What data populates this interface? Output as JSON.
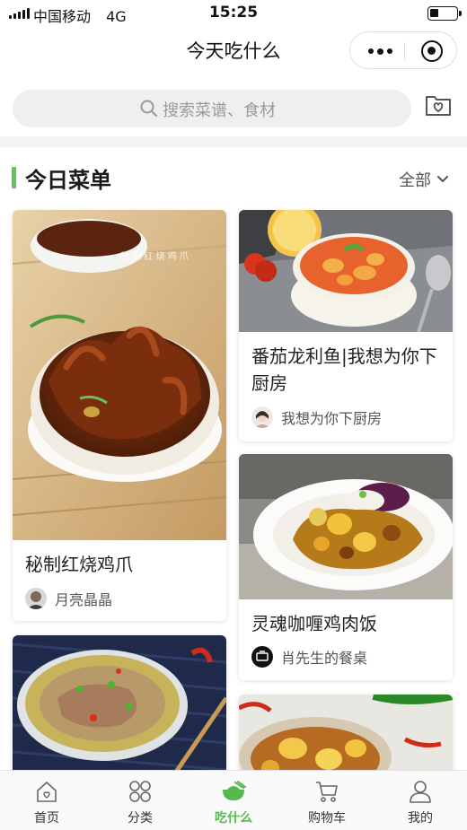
{
  "status_bar": {
    "carrier": "中国移动",
    "network": "4G",
    "time": "15:25"
  },
  "nav": {
    "title": "今天吃什么"
  },
  "search": {
    "placeholder": "搜索菜谱、食材"
  },
  "section": {
    "title": "今日菜单",
    "filter_label": "全部"
  },
  "colors": {
    "accent": "#5ec65b",
    "tab_active": "#55b94d"
  },
  "recipes": [
    {
      "name": "秘制红烧鸡爪",
      "author": "月亮晶晶"
    },
    {
      "name": "番茄龙利鱼|我想为你下厨房",
      "author": "我想为你下厨房"
    },
    {
      "name": "灵魂咖喱鸡肉饭",
      "author": "肖先生的餐桌"
    },
    {
      "name": "",
      "author": ""
    },
    {
      "name": "",
      "author": ""
    }
  ],
  "tabs": [
    {
      "label": "首页",
      "icon": "home-icon"
    },
    {
      "label": "分类",
      "icon": "category-icon"
    },
    {
      "label": "吃什么",
      "icon": "bowl-icon",
      "active": true
    },
    {
      "label": "购物车",
      "icon": "cart-icon"
    },
    {
      "label": "我的",
      "icon": "profile-icon"
    }
  ]
}
